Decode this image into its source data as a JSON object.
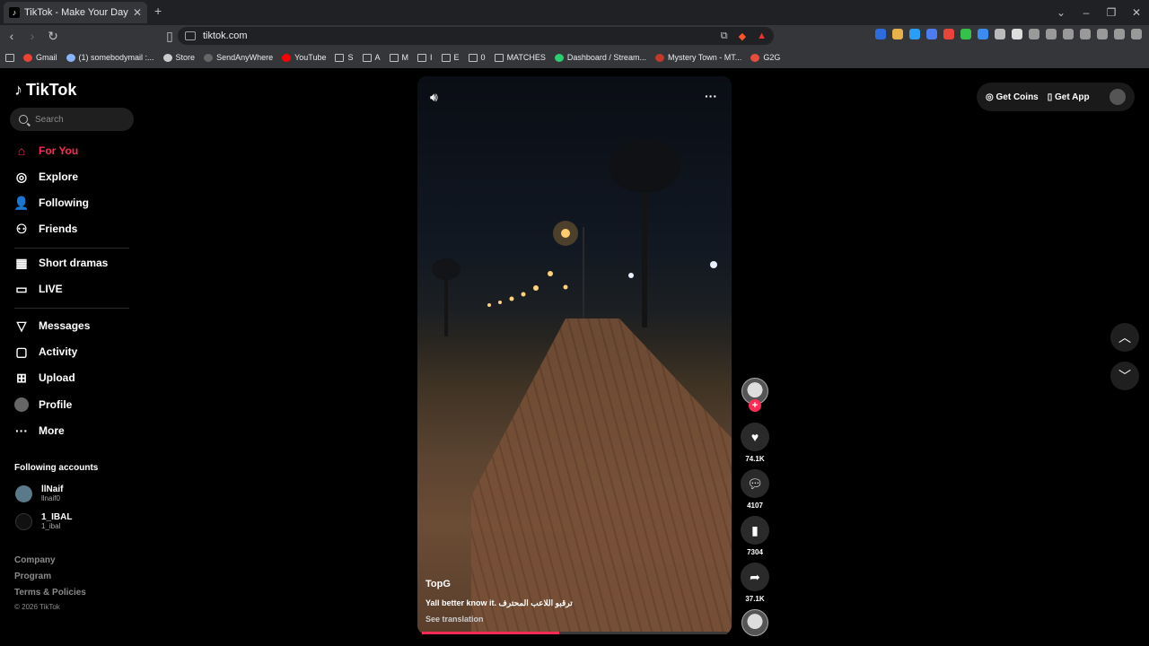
{
  "browser": {
    "tab_title": "TikTok - Make Your Day",
    "url": "tiktok.com",
    "bookmarks": [
      "Gmail",
      "(1) somebodymail :...",
      "Store",
      "SendAnyWhere",
      "YouTube",
      "S",
      "A",
      "M",
      "I",
      "E",
      "0",
      "MATCHES",
      "Dashboard / Stream...",
      "Mystery Town - MT...",
      "G2G"
    ]
  },
  "sidebar": {
    "logo": "TikTok",
    "search_placeholder": "Search",
    "nav": [
      {
        "label": "For You",
        "icon": "home-icon"
      },
      {
        "label": "Explore",
        "icon": "compass-icon"
      },
      {
        "label": "Following",
        "icon": "following-icon"
      },
      {
        "label": "Friends",
        "icon": "friends-icon"
      },
      {
        "label": "Short dramas",
        "icon": "film-icon"
      },
      {
        "label": "LIVE",
        "icon": "tv-icon"
      },
      {
        "label": "Messages",
        "icon": "send-icon"
      },
      {
        "label": "Activity",
        "icon": "chat-icon"
      },
      {
        "label": "Upload",
        "icon": "plus-icon"
      },
      {
        "label": "Profile",
        "icon": "avatar-icon"
      },
      {
        "label": "More",
        "icon": "ellipsis-icon"
      }
    ],
    "following_title": "Following accounts",
    "accounts": [
      {
        "name": "llNaif",
        "handle": "llnaif0"
      },
      {
        "name": "1_IBAL",
        "handle": "1_ibal"
      }
    ],
    "footer": [
      "Company",
      "Program",
      "Terms & Policies"
    ],
    "copyright": "© 2026 TikTok"
  },
  "video": {
    "author": "TopG",
    "caption": "Yall better know it. ترقبو اللاعب المحترف",
    "see_translation": "See translation",
    "progress_fraction": 0.45
  },
  "actions": {
    "likes": "74.1K",
    "comments": "4107",
    "saves": "7304",
    "shares": "37.1K"
  },
  "topright": {
    "coins": "Get Coins",
    "app": "Get App"
  }
}
